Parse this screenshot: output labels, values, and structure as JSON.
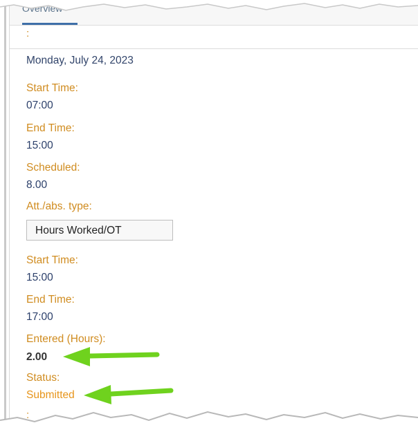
{
  "tabs": {
    "active_label": "Overview"
  },
  "header": {
    "colon": ":"
  },
  "day": {
    "date": "Monday, July 24, 2023"
  },
  "schedule": {
    "start_label": "Start Time:",
    "start_value": "07:00",
    "end_label": "End Time:",
    "end_value": "15:00",
    "scheduled_label": "Scheduled:",
    "scheduled_value": "8.00"
  },
  "attendance": {
    "type_label": "Att./abs. type:",
    "type_value": "Hours Worked/OT",
    "start_label": "Start Time:",
    "start_value": "15:00",
    "end_label": "End Time:",
    "end_value": "17:00",
    "entered_label": "Entered (Hours):",
    "entered_value": "2.00",
    "status_label": "Status:",
    "status_value": "Submitted"
  },
  "footer": {
    "colon": ":"
  },
  "colors": {
    "label": "#d08c20",
    "value": "#2b3f6a",
    "status": "#e7951b",
    "annotation_arrow": "#6fd21e"
  },
  "annotations": [
    "green-arrow",
    "green-arrow"
  ]
}
